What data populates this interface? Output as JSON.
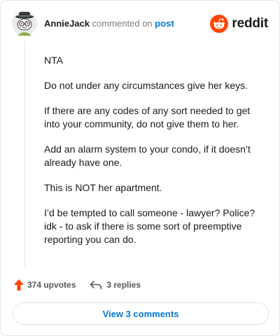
{
  "header": {
    "username": "AnnieJack",
    "action_text": "commented on",
    "link_text": "post"
  },
  "brand": {
    "name": "reddit",
    "icon": "reddit-logo-icon",
    "accent": "#ff4500"
  },
  "comment": {
    "paragraphs": [
      "NTA",
      "Do not under any circumstances give her keys.",
      "If there are any codes of any sort needed to get into your community, do not give them to her.",
      "Add an alarm system to your condo, if it doesn’t already have one.",
      "This is NOT her apartment.",
      "I’d be tempted to call someone - lawyer? Police? idk - to ask if there is some sort of preemptive reporting you can do."
    ]
  },
  "actions": {
    "upvotes": "374 upvotes",
    "replies": "3 replies",
    "upvote_icon": "upvote-arrow-icon",
    "reply_icon": "reply-arrow-icon"
  },
  "footer": {
    "view_comments": "View 3 comments"
  },
  "colors": {
    "link": "#0079d3",
    "upvote": "#ff4500",
    "border": "#e3e5e8"
  }
}
